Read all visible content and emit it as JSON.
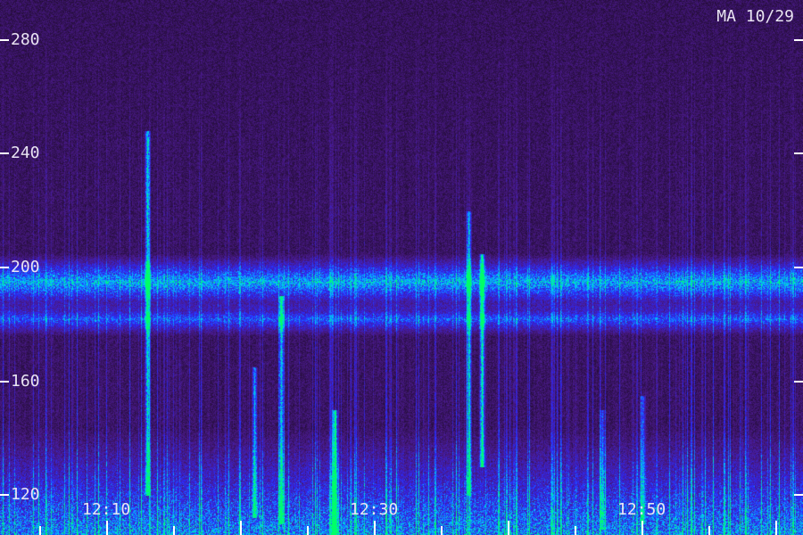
{
  "stamp": "MA 10/29",
  "chart_data": {
    "type": "heatmap",
    "title": "",
    "xlabel": "",
    "ylabel": "",
    "y_ticks": [
      280,
      240,
      200,
      160,
      120
    ],
    "x_ticks": [
      "12:10",
      "12:30",
      "12:50"
    ],
    "ylim": [
      106,
      294
    ],
    "x_range": [
      "12:02",
      "13:02"
    ],
    "grid": false,
    "colors": {
      "background": "#1c0a26",
      "noise": "#4a1a8a",
      "mid": "#2a2aff",
      "high": "#00c8ff",
      "peak": "#00ff66"
    },
    "bands": [
      {
        "center": 195,
        "width": 5,
        "intensity": 0.75
      },
      {
        "center": 182,
        "width": 3,
        "intensity": 0.55
      }
    ],
    "bursts": [
      {
        "time": "12:13",
        "from": 120,
        "to": 248,
        "intensity": 0.9
      },
      {
        "time": "12:21",
        "from": 112,
        "to": 165,
        "intensity": 0.7
      },
      {
        "time": "12:23",
        "from": 110,
        "to": 190,
        "intensity": 0.8
      },
      {
        "time": "12:27",
        "from": 106,
        "to": 150,
        "intensity": 1.0
      },
      {
        "time": "12:37",
        "from": 120,
        "to": 220,
        "intensity": 0.65
      },
      {
        "time": "12:38",
        "from": 130,
        "to": 205,
        "intensity": 0.95
      },
      {
        "time": "12:47",
        "from": 108,
        "to": 150,
        "intensity": 0.5
      },
      {
        "time": "12:50",
        "from": 110,
        "to": 155,
        "intensity": 0.55
      }
    ]
  }
}
